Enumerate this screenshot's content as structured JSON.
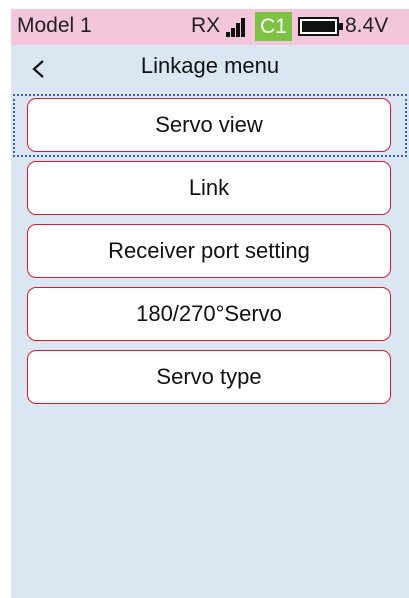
{
  "status": {
    "model_name": "Model 1",
    "rx_label": "RX",
    "channel_badge": "C1",
    "battery_voltage": "8.4V",
    "battery_level": 1.0,
    "colors": {
      "status_bg": "#f3c6dc",
      "badge_bg": "#7dc242",
      "screen_bg": "#dbe6f3",
      "button_border": "#e0192c"
    }
  },
  "header": {
    "back_icon": "chevron-left-icon",
    "title": "Linkage menu"
  },
  "menu": {
    "items": [
      {
        "label": "Servo view",
        "selected": true
      },
      {
        "label": "Link"
      },
      {
        "label": "Receiver port setting"
      },
      {
        "label": "180/270°Servo"
      },
      {
        "label": "Servo type"
      }
    ]
  }
}
